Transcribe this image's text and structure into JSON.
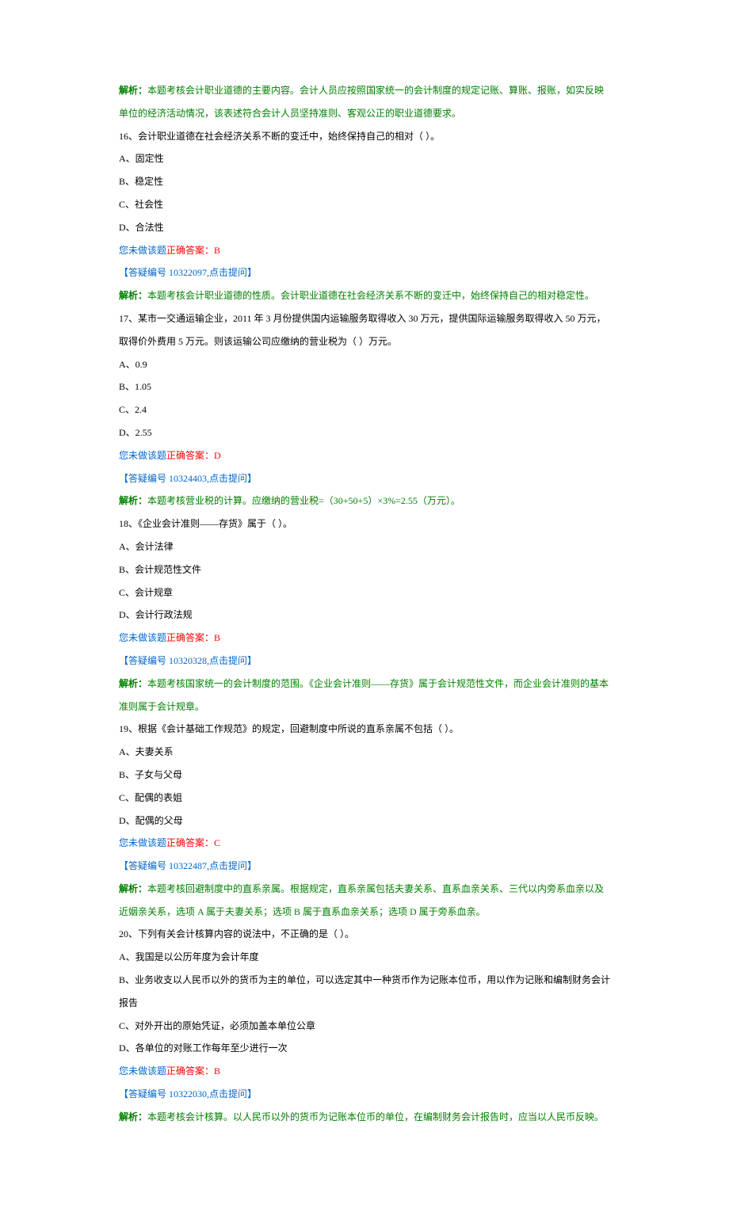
{
  "q15": {
    "analysisLabel": "解析：",
    "analysisText": "本题考核会计职业道德的主要内容。会计人员应按照国家统一的会计制度的规定记账、算账、报账，如实反映单位的经济活动情况，该表述符合会计人员坚持准则、客观公正的职业道德要求。"
  },
  "q16": {
    "question": "16、会计职业道德在社会经济关系不断的变迁中，始终保持自己的相对（ ）。",
    "optA": "A、固定性",
    "optB": "B、稳定性",
    "optC": "C、社会性",
    "optD": "D、合法性",
    "notDone": "您未做该题",
    "correctLabel": "正确答案：B",
    "queryLink": "【答疑编号 10322097,点击提问】",
    "analysisLabel": "解析：",
    "analysisText": "本题考核会计职业道德的性质。会计职业道德在社会经济关系不断的变迁中，始终保持自己的相对稳定性。"
  },
  "q17": {
    "question": "17、某市一交通运输企业，2011 年 3 月份提供国内运输服务取得收入 30 万元，提供国际运输服务取得收入 50 万元，取得价外费用 5 万元。则该运输公司应缴纳的营业税为（ ）万元。",
    "optA": "A、0.9",
    "optB": "B、1.05",
    "optC": "C、2.4",
    "optD": "D、2.55",
    "notDone": "您未做该题",
    "correctLabel": "正确答案：D",
    "queryLink": "【答疑编号 10324403,点击提问】",
    "analysisLabel": "解析：",
    "analysisText": "本题考核营业税的计算。应缴纳的营业税=（30+50+5）×3%=2.55（万元）。"
  },
  "q18": {
    "question": "18、《企业会计准则——存货》属于（ ）。",
    "optA": "A、会计法律",
    "optB": "B、会计规范性文件",
    "optC": "C、会计规章",
    "optD": "D、会计行政法规",
    "notDone": "您未做该题",
    "correctLabel": "正确答案：B",
    "queryLink": "【答疑编号 10320328,点击提问】",
    "analysisLabel": "解析：",
    "analysisText": "本题考核国家统一的会计制度的范围。《企业会计准则——存货》属于会计规范性文件，而企业会计准则的基本准则属于会计规章。"
  },
  "q19": {
    "question": "19、根据《会计基础工作规范》的规定，回避制度中所说的直系亲属不包括（ ）。",
    "optA": "A、夫妻关系",
    "optB": "B、子女与父母",
    "optC": "C、配偶的表姐",
    "optD": "D、配偶的父母",
    "notDone": "您未做该题",
    "correctLabel": "正确答案：C",
    "queryLink": "【答疑编号 10322487,点击提问】",
    "analysisLabel": "解析：",
    "analysisText": "本题考核回避制度中的直系亲属。根据规定，直系亲属包括夫妻关系、直系血亲关系、三代以内旁系血亲以及近姻亲关系，选项 A 属于夫妻关系；选项 B 属于直系血亲关系；选项 D 属于旁系血亲。"
  },
  "q20": {
    "question": "20、下列有关会计核算内容的说法中，不正确的是（ ）。",
    "optA": "A、我国是以公历年度为会计年度",
    "optB": "B、业务收支以人民币以外的货币为主的单位，可以选定其中一种货币作为记账本位币，用以作为记账和编制财务会计报告",
    "optC": "C、对外开出的原始凭证，必须加盖本单位公章",
    "optD": "D、各单位的对账工作每年至少进行一次",
    "notDone": "您未做该题",
    "correctLabel": "正确答案：B",
    "queryLink": "【答疑编号 10322030,点击提问】",
    "analysisLabel": "解析：",
    "analysisText": "本题考核会计核算。以人民币以外的货币为记账本位币的单位，在编制财务会计报告时，应当以人民币反映。"
  }
}
